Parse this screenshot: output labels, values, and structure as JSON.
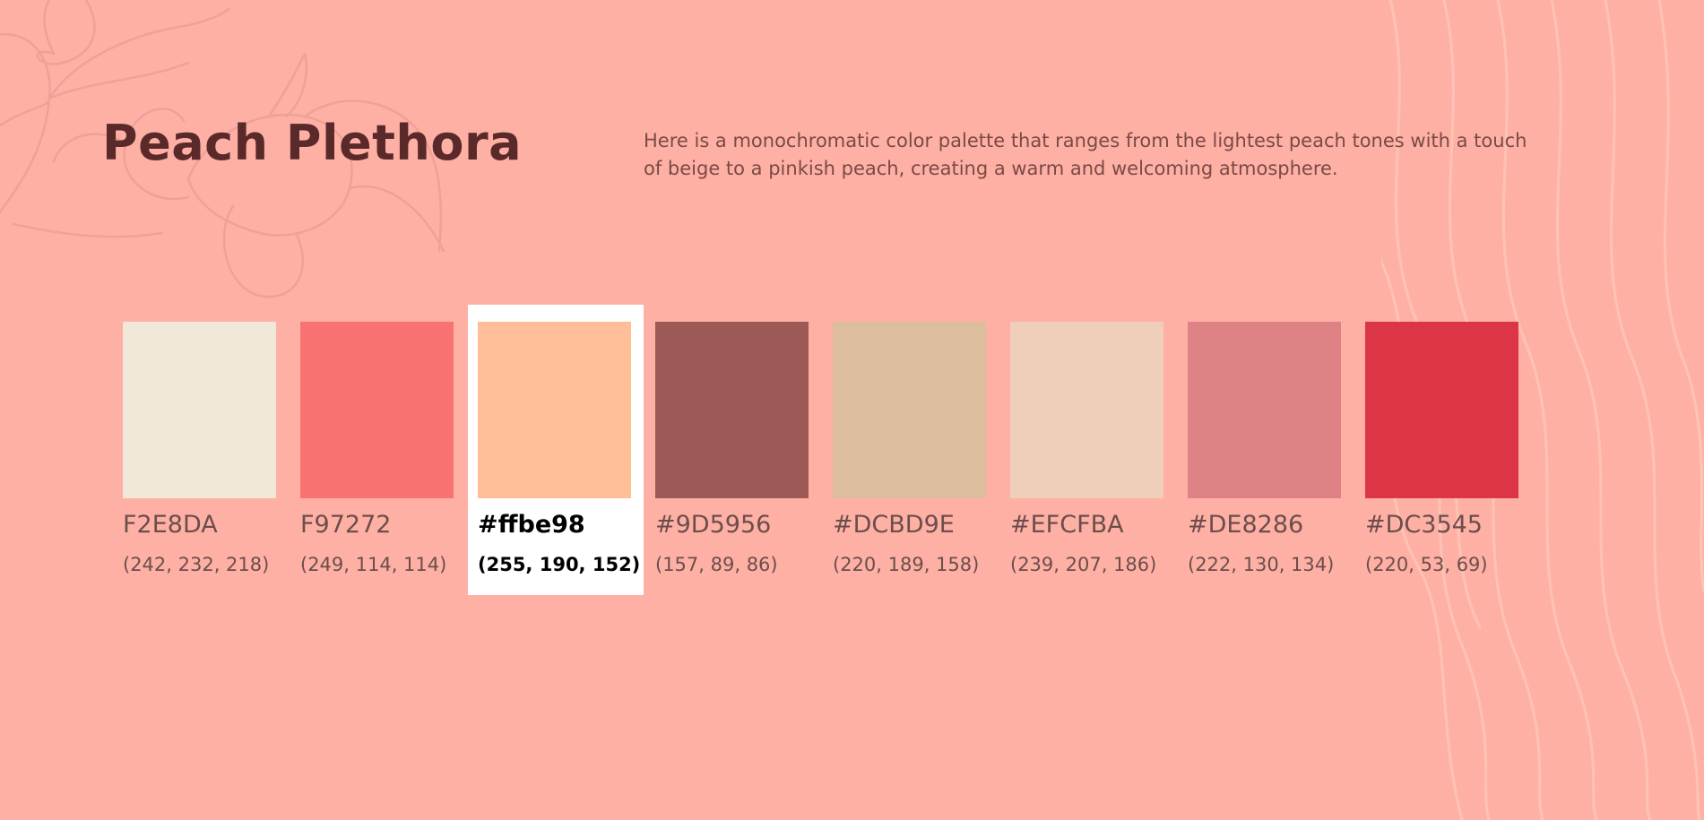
{
  "page": {
    "title": "Peach Plethora",
    "description": "Here is a monochromatic color palette that ranges from the lightest peach tones with a touch of beige to a pinkish peach, creating a warm and welcoming atmosphere.",
    "background_color": "#FFB0A5",
    "title_color": "#5A2A2A"
  },
  "palette": {
    "selected_index": 2,
    "swatches": [
      {
        "hex_label": "F2E8DA",
        "rgb_label": "(242, 232, 218)",
        "color": "#F2E8DA"
      },
      {
        "hex_label": "F97272",
        "rgb_label": "(249, 114, 114)",
        "color": "#F97272"
      },
      {
        "hex_label": "#ffbe98",
        "rgb_label": "(255, 190, 152)",
        "color": "#FFBE98"
      },
      {
        "hex_label": "#9D5956",
        "rgb_label": "(157, 89, 86)",
        "color": "#9D5956"
      },
      {
        "hex_label": "#DCBD9E",
        "rgb_label": "(220, 189, 158)",
        "color": "#DCBD9E"
      },
      {
        "hex_label": "#EFCFBA",
        "rgb_label": "(239, 207, 186)",
        "color": "#EFCFBA"
      },
      {
        "hex_label": "#DE8286",
        "rgb_label": "(222, 130, 134)",
        "color": "#DE8286"
      },
      {
        "hex_label": "#DC3545",
        "rgb_label": "(220, 53, 69)",
        "color": "#DC3545"
      }
    ]
  }
}
